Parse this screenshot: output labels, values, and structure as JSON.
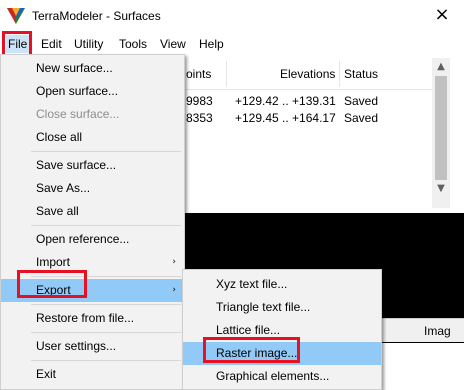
{
  "window": {
    "title": "TerraModeler - Surfaces",
    "close_glyph": "×"
  },
  "menubar": {
    "items": [
      "File",
      "Edit",
      "Utility",
      "Tools",
      "View",
      "Help"
    ]
  },
  "list": {
    "headers": [
      "oints",
      "Elevations",
      "Status"
    ],
    "rows": [
      {
        "points": "9983",
        "elevations": "+129.42 .. +139.31",
        "status": "Saved"
      },
      {
        "points": "8353",
        "elevations": "+129.45 .. +164.17",
        "status": "Saved"
      }
    ]
  },
  "file_menu": {
    "items": [
      {
        "label": "New surface...",
        "disabled": false
      },
      {
        "label": "Open surface...",
        "disabled": false
      },
      {
        "label": "Close surface...",
        "disabled": true
      },
      {
        "label": "Close all",
        "disabled": false
      },
      {
        "label": "Save surface...",
        "disabled": false
      },
      {
        "label": "Save As...",
        "disabled": false
      },
      {
        "label": "Save all",
        "disabled": false
      },
      {
        "label": "Open reference...",
        "disabled": false
      },
      {
        "label": "Import",
        "disabled": false,
        "submenu": true
      },
      {
        "label": "Export",
        "disabled": false,
        "submenu": true,
        "highlighted": true
      },
      {
        "label": "Restore from file...",
        "disabled": false
      },
      {
        "label": "User settings...",
        "disabled": false
      },
      {
        "label": "Exit",
        "disabled": false
      }
    ],
    "submenu_arrow": "›"
  },
  "export_menu": {
    "items": [
      {
        "label": "Xyz text file..."
      },
      {
        "label": "Triangle text file..."
      },
      {
        "label": "Lattice file..."
      },
      {
        "label": "Raster image...",
        "highlighted": true
      },
      {
        "label": "Graphical elements..."
      }
    ]
  },
  "lower_window": {
    "header_fragment": "Imag"
  },
  "colors": {
    "highlight": "#91c9f7",
    "annotation_box": "#e81123",
    "menu_bg": "#f2f2f2"
  },
  "icons": {
    "app_logo": "terramodeler-logo-icon",
    "scroll_up": "▲",
    "scroll_down": "▼"
  }
}
